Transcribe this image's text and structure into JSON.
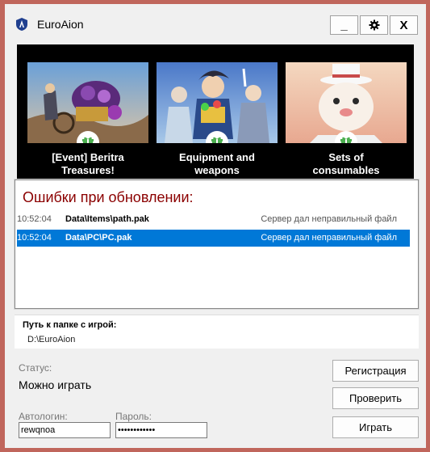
{
  "window": {
    "title": "EuroAion",
    "minimize_label": "_",
    "close_label": "X"
  },
  "banners": [
    {
      "caption_line1": "[Event] Beritra",
      "caption_line2": "Treasures!"
    },
    {
      "caption_line1": "Equipment and",
      "caption_line2": "weapons"
    },
    {
      "caption_line1": "Sets of",
      "caption_line2": "consumables"
    }
  ],
  "errors": {
    "title": "Ошибки при обновлении:",
    "rows": [
      {
        "time": "10:52:04",
        "path": "Data\\Items\\path.pak",
        "message": "Сервер дал неправильный файл",
        "selected": false
      },
      {
        "time": "10:52:04",
        "path": "Data\\PC\\PC.pak",
        "message": "Сервер дал неправильный файл",
        "selected": true
      }
    ]
  },
  "game_folder": {
    "label": "Путь к папке с игрой:",
    "value": "D:\\EuroAion"
  },
  "status": {
    "label": "Статус:",
    "value": "Можно играть"
  },
  "buttons": {
    "register": "Регистрация",
    "check": "Проверить",
    "play": "Играть"
  },
  "autologin": {
    "label": "Автологин:",
    "value": "rewqnoa"
  },
  "password": {
    "label": "Пароль:",
    "value": "••••••••••••"
  },
  "colors": {
    "background": "#c0665c",
    "error_title": "#8b0000",
    "selection": "#0078d7",
    "gift_icon": "#4caf50"
  }
}
